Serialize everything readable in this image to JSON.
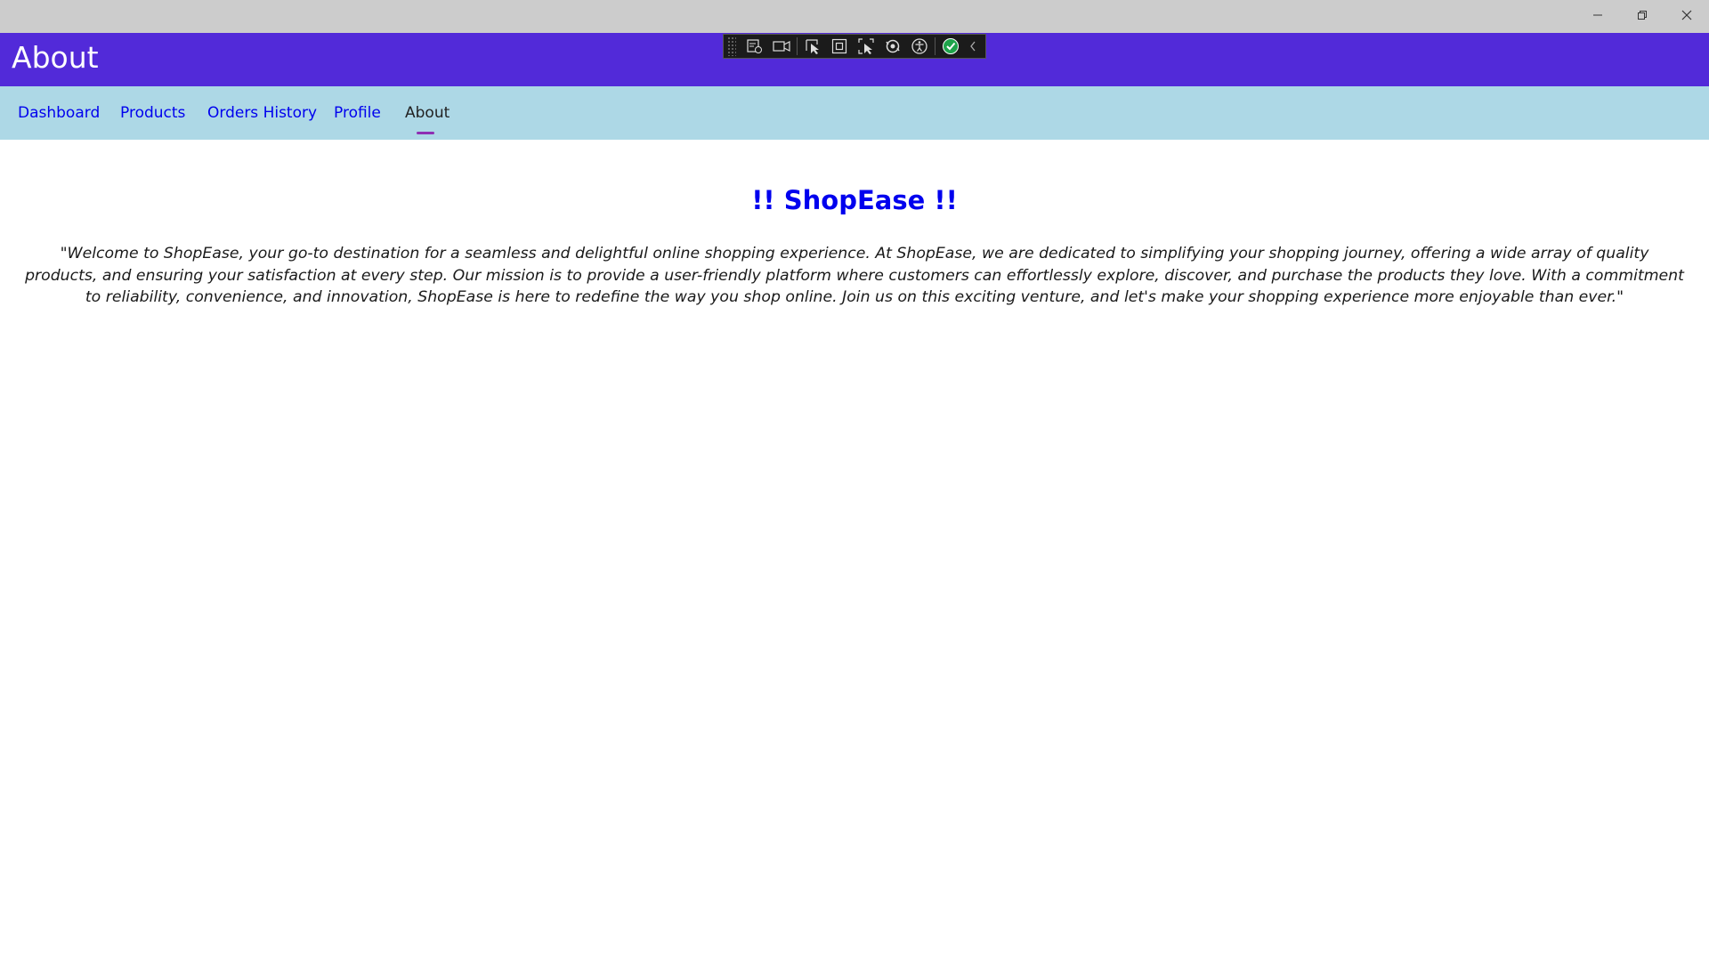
{
  "window": {
    "controls": [
      "minimize",
      "restore",
      "close"
    ]
  },
  "header": {
    "title": "About",
    "background": "#522ad9"
  },
  "debug_toolbar": {
    "icons": [
      "live-visual-tree-icon",
      "record-icon",
      "select-element-icon",
      "display-layout-adorners-icon",
      "track-focus-icon",
      "hot-reload-icon",
      "accessibility-icon",
      "accessibility-check-icon",
      "collapse-icon"
    ]
  },
  "nav": {
    "items": [
      {
        "label": "Dashboard"
      },
      {
        "label": "Products"
      },
      {
        "label": "Orders History"
      },
      {
        "label": "Profile"
      },
      {
        "label": "About"
      }
    ],
    "active": "About",
    "background": "#add8e6",
    "indicator_color": "#8e2fb3"
  },
  "main": {
    "brand": "!! ShopEase !!",
    "description": "\"Welcome to ShopEase, your go-to destination for a seamless and delightful online shopping experience. At ShopEase, we are dedicated to simplifying your shopping journey, offering a wide array of quality products, and ensuring your satisfaction at every step. Our mission is to provide a user-friendly platform where customers can effortlessly explore, discover, and purchase the products they love. With a commitment to reliability, convenience, and innovation, ShopEase is here to redefine the way you shop online. Join us on this exciting venture, and let's make your shopping experience more enjoyable than ever.\""
  }
}
